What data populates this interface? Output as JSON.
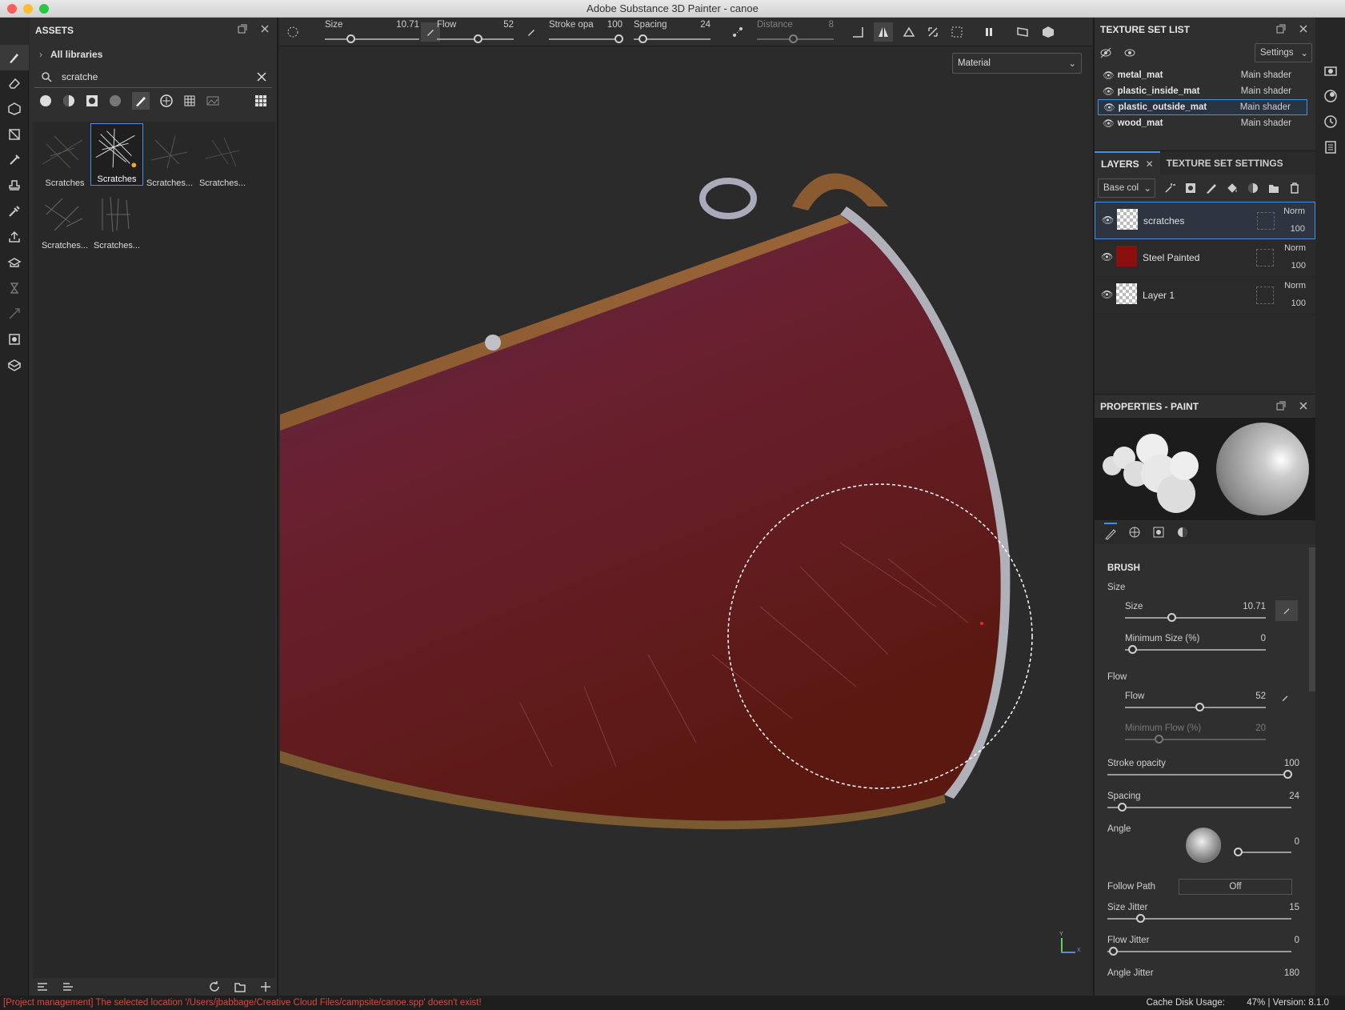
{
  "window": {
    "title": "Adobe Substance 3D Painter - canoe"
  },
  "assets": {
    "title": "ASSETS",
    "breadcrumb": "All libraries",
    "search_value": "scratche",
    "items": [
      "Scratches",
      "Scratches",
      "Scratches...",
      "Scratches...",
      "Scratches...",
      "Scratches..."
    ]
  },
  "toolbar": {
    "size_label": "Size",
    "size_value": "10.71",
    "flow_label": "Flow",
    "flow_value": "52",
    "stroke_label": "Stroke opa",
    "stroke_value": "100",
    "spacing_label": "Spacing",
    "spacing_value": "24",
    "distance_label": "Distance",
    "distance_value": "8"
  },
  "viewport": {
    "mode": "Material",
    "axis_y": "Y",
    "axis_x": "X"
  },
  "texture_set_list": {
    "title": "TEXTURE SET LIST",
    "settings_label": "Settings",
    "items": [
      {
        "name": "metal_mat",
        "shader": "Main shader"
      },
      {
        "name": "plastic_inside_mat",
        "shader": "Main shader"
      },
      {
        "name": "plastic_outside_mat",
        "shader": "Main shader"
      },
      {
        "name": "wood_mat",
        "shader": "Main shader"
      }
    ]
  },
  "layers": {
    "tab_layers": "LAYERS",
    "tab_settings": "TEXTURE SET SETTINGS",
    "channel": "Base col",
    "items": [
      {
        "name": "scratches",
        "blend": "Norm",
        "opacity": "100"
      },
      {
        "name": "Steel Painted",
        "blend": "Norm",
        "opacity": "100"
      },
      {
        "name": "Layer 1",
        "blend": "Norm",
        "opacity": "100"
      }
    ]
  },
  "properties": {
    "title": "PROPERTIES - PAINT",
    "section": "BRUSH",
    "size_group": "Size",
    "size_label": "Size",
    "size_value": "10.71",
    "min_size_label": "Minimum Size (%)",
    "min_size_value": "0",
    "flow_group": "Flow",
    "flow_label": "Flow",
    "flow_value": "52",
    "min_flow_label": "Minimum Flow (%)",
    "min_flow_value": "20",
    "stroke_label": "Stroke opacity",
    "stroke_value": "100",
    "spacing_label": "Spacing",
    "spacing_value": "24",
    "angle_label": "Angle",
    "angle_value": "0",
    "follow_label": "Follow Path",
    "follow_value": "Off",
    "size_jitter_label": "Size Jitter",
    "size_jitter_value": "15",
    "flow_jitter_label": "Flow Jitter",
    "flow_jitter_value": "0",
    "angle_jitter_label": "Angle Jitter",
    "angle_jitter_value": "180"
  },
  "status": {
    "message": "[Project management] The selected location '/Users/jbabbage/Creative Cloud Files/campsite/canoe.spp' doesn't exist!",
    "cache": "Cache Disk Usage:",
    "cache_value": "47% | Version: 8.1.0"
  },
  "colors": {
    "accent": "#4a90e2",
    "error": "#e0483c",
    "hull": "#7a1f1f"
  }
}
